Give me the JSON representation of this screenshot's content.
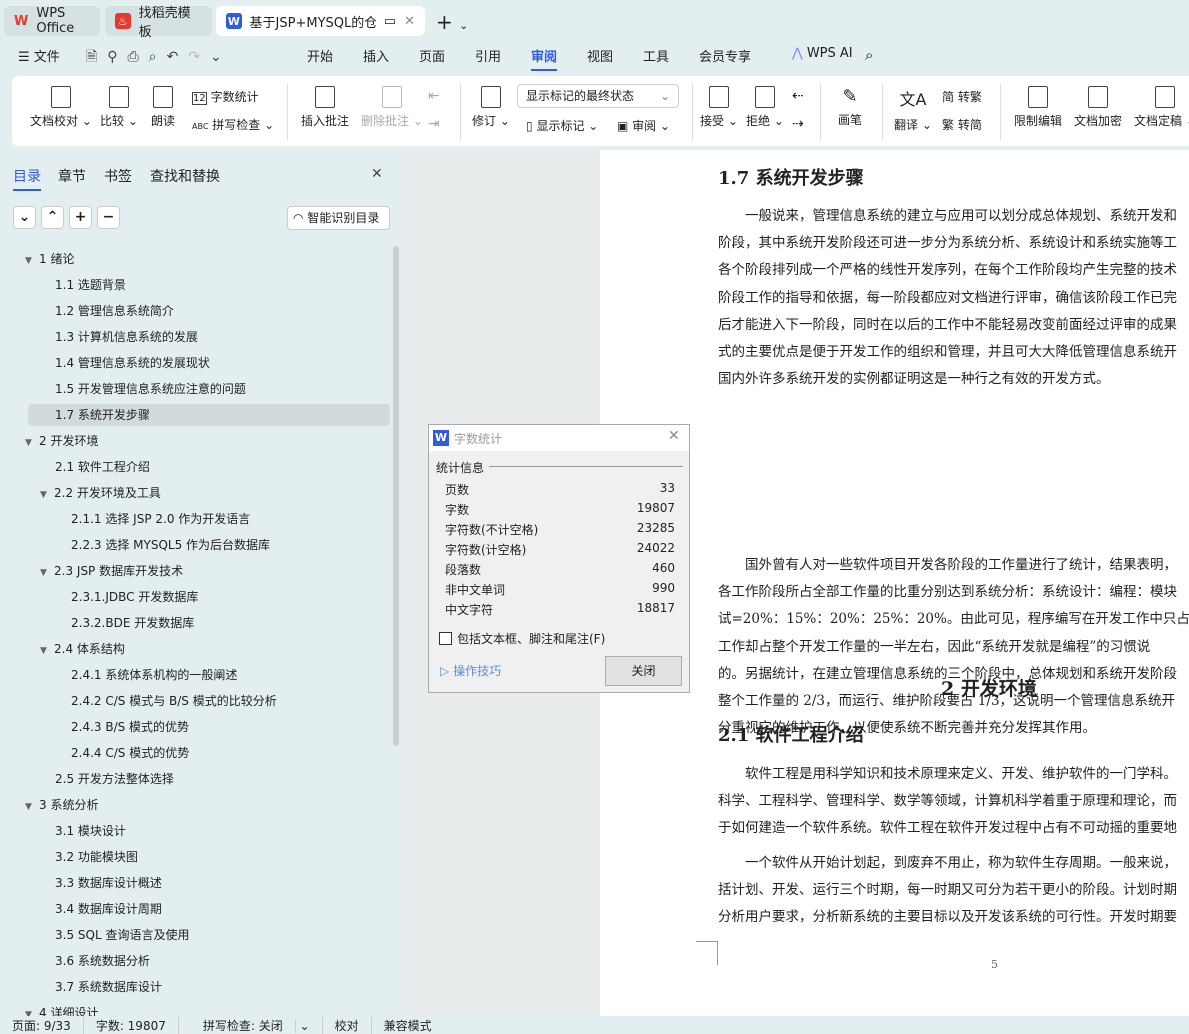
{
  "tabs": [
    {
      "label": "WPS Office"
    },
    {
      "label": "找稻壳模板"
    },
    {
      "label": "基于JSP+MYSQL的仓库管理系"
    }
  ],
  "menu": {
    "file": "文件",
    "items": [
      "开始",
      "插入",
      "页面",
      "引用",
      "审阅",
      "视图",
      "工具",
      "会员专享"
    ],
    "active": "审阅",
    "ai": "WPS AI"
  },
  "ribbon": {
    "proofread": "文档校对",
    "compare": "比较",
    "read": "朗读",
    "wordcount": "字数统计",
    "spell": "拼写检查",
    "insert_comment": "插入批注",
    "delete_comment": "删除批注",
    "revise": "修订",
    "markup_state": "显示标记的最终状态",
    "show_markup": "显示标记",
    "review": "审阅",
    "accept": "接受",
    "reject": "拒绝",
    "pen": "画笔",
    "translate": "翻译",
    "to_trad": "转繁",
    "to_simp": "转简",
    "restrict": "限制编辑",
    "encrypt": "文档加密",
    "finalize": "文档定稿"
  },
  "sidebar": {
    "tabs": [
      "目录",
      "章节",
      "书签",
      "查找和替换"
    ],
    "active": "目录",
    "smart": "智能识别目录",
    "items": [
      {
        "label": "1  绪论",
        "level": 1,
        "arrow": true
      },
      {
        "label": "1.1  选题背景",
        "level": 2
      },
      {
        "label": "1.2  管理信息系统简介",
        "level": 2
      },
      {
        "label": "1.3  计算机信息系统的发展",
        "level": 2
      },
      {
        "label": "1.4  管理信息系统的发展现状",
        "level": 2
      },
      {
        "label": "1.5  开发管理信息系统应注意的问题",
        "level": 2
      },
      {
        "label": "1.7  系统开发步骤",
        "level": 2,
        "selected": true
      },
      {
        "label": "2  开发环境",
        "level": 1,
        "arrow": true
      },
      {
        "label": "2.1  软件工程介绍",
        "level": 2
      },
      {
        "label": "2.2 开发环境及工具",
        "level": 2,
        "arrow": true
      },
      {
        "label": "2.1.1 选择 JSP 2.0 作为开发语言",
        "level": 3
      },
      {
        "label": "2.2.3 选择 MYSQL5  作为后台数据库",
        "level": 3
      },
      {
        "label": "2.3 JSP 数据库开发技术",
        "level": 2,
        "arrow": true
      },
      {
        "label": "2.3.1.JDBC 开发数据库",
        "level": 3
      },
      {
        "label": "2.3.2.BDE 开发数据库",
        "level": 3
      },
      {
        "label": "2.4  体系结构",
        "level": 2,
        "arrow": true
      },
      {
        "label": "2.4.1  系统体系机构的一般阐述",
        "level": 3
      },
      {
        "label": "2.4.2 C/S 模式与 B/S 模式的比较分析",
        "level": 3
      },
      {
        "label": "2.4.3 B/S 模式的优势",
        "level": 3
      },
      {
        "label": "2.4.4 C/S 模式的优势",
        "level": 3
      },
      {
        "label": "2.5  开发方法整体选择",
        "level": 2
      },
      {
        "label": "3  系统分析",
        "level": 1,
        "arrow": true
      },
      {
        "label": "3.1  模块设计",
        "level": 2
      },
      {
        "label": "3.2  功能模块图",
        "level": 2
      },
      {
        "label": "3.3  数据库设计概述",
        "level": 2
      },
      {
        "label": "3.4  数据库设计周期",
        "level": 2
      },
      {
        "label": "3.5 SQL 查询语言及使用",
        "level": 2
      },
      {
        "label": "3.6  系统数据分析",
        "level": 2
      },
      {
        "label": "3.7  系统数据库设计",
        "level": 2
      },
      {
        "label": "4  详细设计",
        "level": 1,
        "arrow": true
      }
    ]
  },
  "document": {
    "h17": "1.7 系统开发步骤",
    "para1": [
      "一般说来，管理信息系统的建立与应用可以划分成总体规划、系统开发和",
      "阶段，其中系统开发阶段还可进一步分为系统分析、系统设计和系统实施等工",
      "各个阶段排列成一个严格的线性开发序列，在每个工作阶段均产生完整的技术",
      "阶段工作的指导和依据，每一阶段都应对文档进行评审，确信该阶段工作已完",
      "后才能进入下一阶段，同时在以后的工作中不能轻易改变前面经过评审的成果",
      "式的主要优点是便于开发工作的组织和管理，并且可大大降低管理信息系统开",
      "国内外许多系统开发的实例都证明这是一种行之有效的开发方式。"
    ],
    "para2": [
      "国外曾有人对一些软件项目开发各阶段的工作量进行了统计，结果表明，",
      "各工作阶段所占全部工作量的比重分别达到系统分析：系统设计：编程：模块",
      "试=20%：15%：20%：25%：20%。由此可见，程序编写在开发工作中只占很小",
      "工作却占整个开发工作量的一半左右，因此“系统开发就是编程”的习惯说",
      "的。另据统计，在建立管理信息系统的三个阶段中，总体规划和系统开发阶段",
      "整个工作量的 2/3，而运行、维护阶段要占 1/3，这说明一个管理信息系统开",
      "分重视它的维护工作，以便使系统不断完善并充分发挥其作用。"
    ],
    "h2": "2  开发环境",
    "h21": "2.1 软件工程介绍",
    "para3": [
      "软件工程是用科学知识和技术原理来定义、开发、维护软件的一门学科。",
      "科学、工程科学、管理科学、数学等领域，计算机科学着重于原理和理论，而",
      "于如何建造一个软件系统。软件工程在软件开发过程中占有不可动摇的重要地"
    ],
    "para4": [
      "一个软件从开始计划起，到废弃不用止，称为软件生存周期。一般来说，",
      "括计划、开发、运行三个时期，每一时期又可分为若干更小的阶段。计划时期",
      "分析用户要求，分析新系统的主要目标以及开发该系统的可行性。开发时期要"
    ],
    "page_number": "5"
  },
  "dialog": {
    "title": "字数统计",
    "group": "统计信息",
    "rows": [
      [
        "页数",
        "33"
      ],
      [
        "字数",
        "19807"
      ],
      [
        "字符数(不计空格)",
        "23285"
      ],
      [
        "字符数(计空格)",
        "24022"
      ],
      [
        "段落数",
        "460"
      ],
      [
        "非中文单词",
        "990"
      ],
      [
        "中文字符",
        "18817"
      ]
    ],
    "checkbox": "包括文本框、脚注和尾注(F)",
    "checked": false,
    "tips": "操作技巧",
    "close": "关闭"
  },
  "status": {
    "page": "页面: 9/33",
    "words": "字数: 19807",
    "spell": "拼写检查: 关闭",
    "proof": "校对",
    "compat": "兼容模式"
  },
  "colors": {
    "accent": "#2f5be0",
    "wps_red": "#e8392f",
    "selected_row": "#d3dadb"
  }
}
